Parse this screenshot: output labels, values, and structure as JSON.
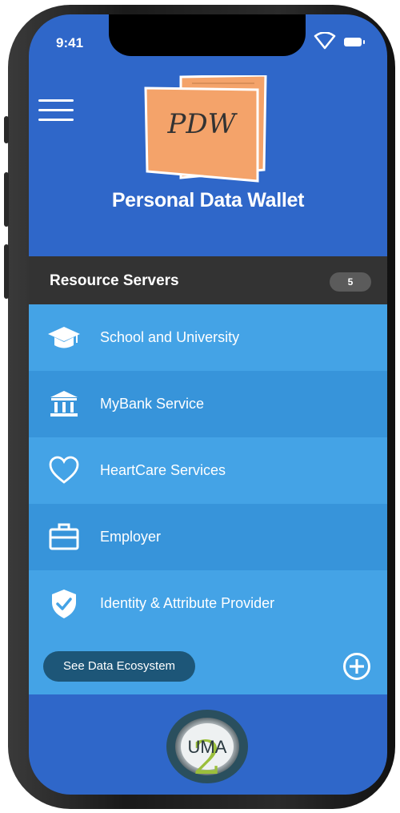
{
  "status_bar": {
    "time": "9:41"
  },
  "header": {
    "logo_text": "PDW",
    "title": "Personal Data Wallet"
  },
  "resource_servers": {
    "title": "Resource Servers",
    "count": "5",
    "items": [
      {
        "label": "School and University",
        "icon": "graduation-cap-icon"
      },
      {
        "label": "MyBank Service",
        "icon": "bank-icon"
      },
      {
        "label": "HeartCare Services",
        "icon": "heart-icon"
      },
      {
        "label": "Employer",
        "icon": "briefcase-icon"
      },
      {
        "label": "Identity & Attribute Provider",
        "icon": "shield-check-icon"
      }
    ]
  },
  "footer": {
    "ecosystem_button": "See Data Ecosystem"
  },
  "bottom_logo": {
    "text": "UMA",
    "number": "2"
  },
  "colors": {
    "header_bg": "#2f67c9",
    "section_header_bg": "#333333",
    "row_light": "#44a3e6",
    "row_dark": "#3794da",
    "ecosystem_button_bg": "#1d5678",
    "logo_orange": "#f4a36a"
  }
}
